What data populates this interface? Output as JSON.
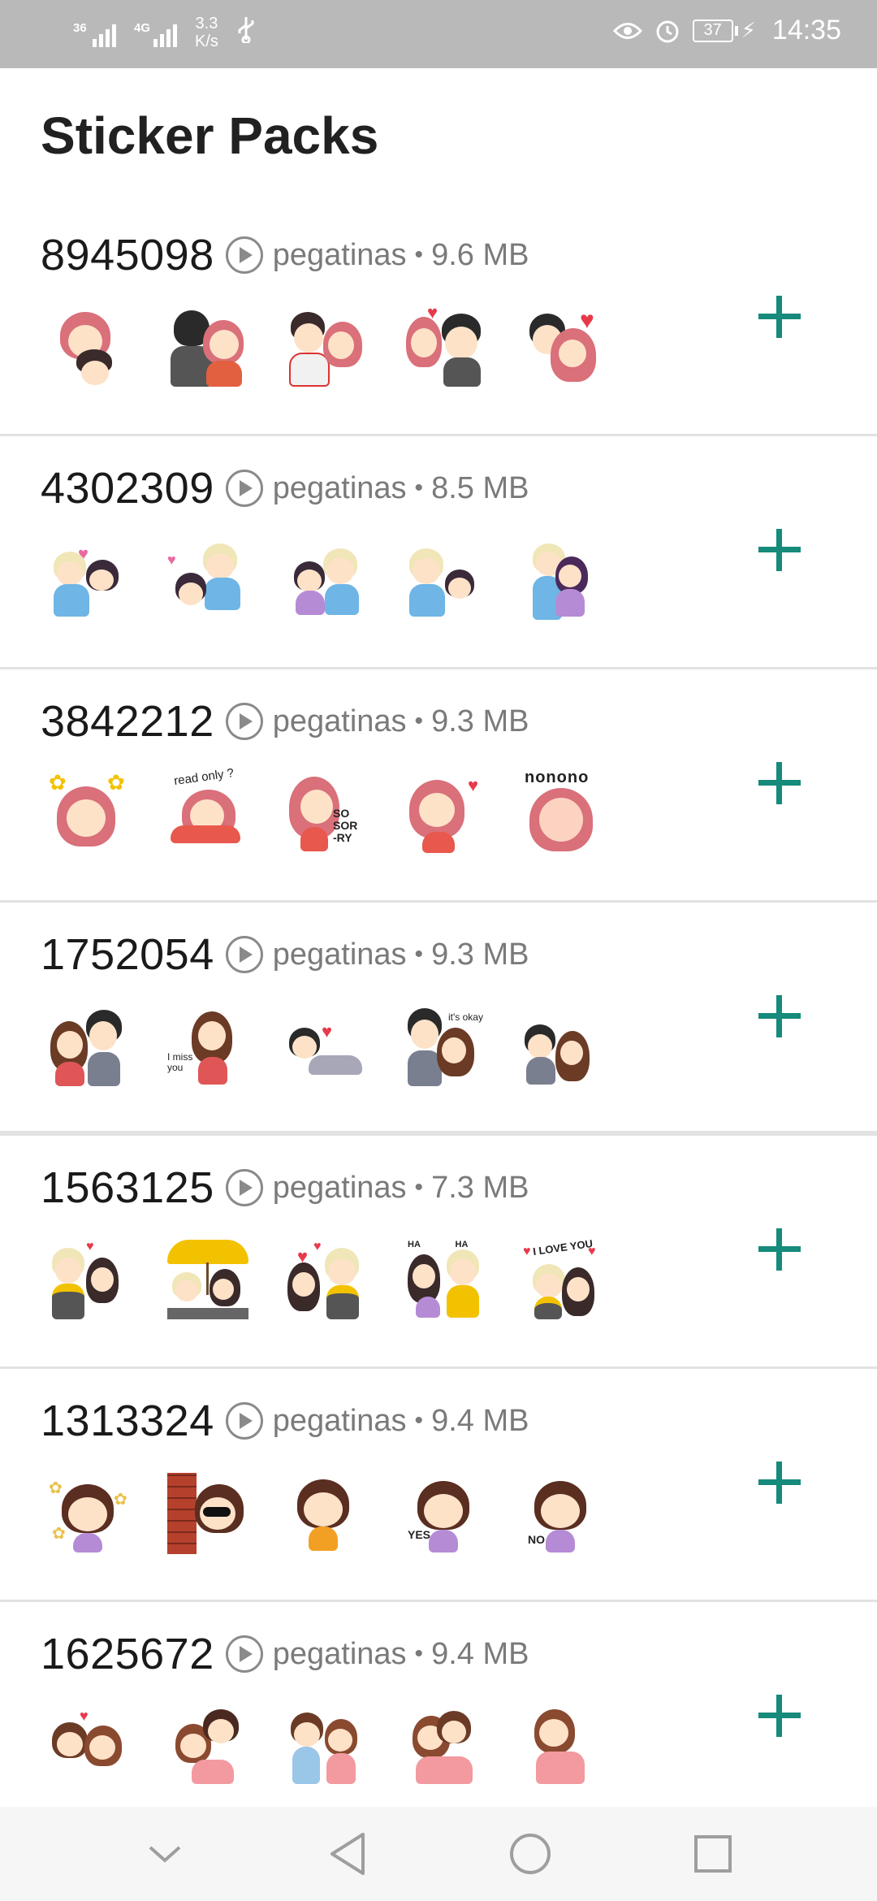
{
  "status_bar": {
    "signal_1_label": "36",
    "signal_2_label": "4G",
    "speed_value": "3.3",
    "speed_unit": "K/s",
    "usb_icon": "usb-icon",
    "eye_icon": "eye-icon",
    "alarm_icon": "alarm-icon",
    "battery_level": "37",
    "time": "14:35"
  },
  "header": {
    "title": "Sticker Packs"
  },
  "packs": [
    {
      "name": "8945098",
      "publisher": "pegatinas",
      "separator": "•",
      "size": "9.6 MB"
    },
    {
      "name": "4302309",
      "publisher": "pegatinas",
      "separator": "•",
      "size": "8.5 MB"
    },
    {
      "name": "3842212",
      "publisher": "pegatinas",
      "separator": "•",
      "size": "9.3 MB"
    },
    {
      "name": "1752054",
      "publisher": "pegatinas",
      "separator": "•",
      "size": "9.3 MB"
    },
    {
      "name": "1563125",
      "publisher": "pegatinas",
      "separator": "•",
      "size": "7.3 MB"
    },
    {
      "name": "1313324",
      "publisher": "pegatinas",
      "separator": "•",
      "size": "9.4 MB"
    },
    {
      "name": "1625672",
      "publisher": "pegatinas",
      "separator": "•",
      "size": "9.4 MB"
    }
  ],
  "sticker_text": {
    "pack3_s2": "read only ?",
    "pack3_s3": "SO SOR -RY",
    "pack3_s5": "nonono",
    "pack4_s2": "I miss you",
    "pack4_s4": "it's okay",
    "pack5_s4": "HA HA",
    "pack5_s5": "I LOVE YOU",
    "pack6_s4": "YES",
    "pack6_s5": "NO"
  },
  "colors": {
    "accent": "#168a7b",
    "status_bar": "#b9b9b9",
    "divider": "#e2e2e2",
    "hair_pink": "#d9707a",
    "hair_dark": "#3a2a2a",
    "hair_blond": "#f0e6b8",
    "hair_brown": "#6b3b26"
  },
  "navbar": {
    "back_icon": "back-triangle-icon",
    "home_icon": "home-circle-icon",
    "recents_icon": "recents-square-icon",
    "hide_icon": "chevron-down-icon"
  }
}
